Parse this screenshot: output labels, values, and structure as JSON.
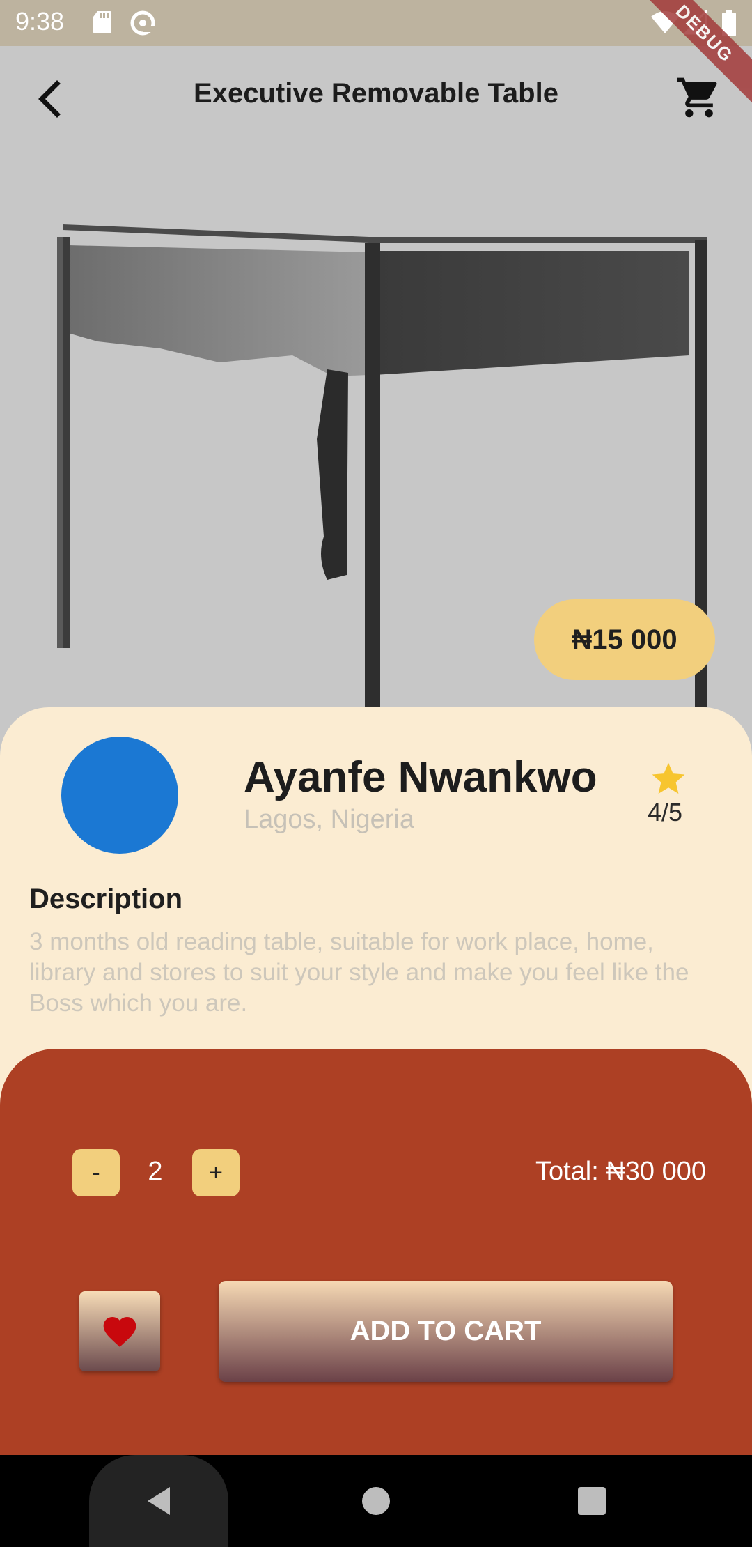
{
  "status_bar": {
    "time": "9:38",
    "icons": [
      "sd-card-icon",
      "data-saver-icon",
      "wifi-icon",
      "signal-icon",
      "battery-icon"
    ],
    "debug_banner": "DEBUG"
  },
  "header": {
    "title": "Executive Removable Table",
    "back_icon": "arrow-back-icon",
    "cart_icon": "cart-icon"
  },
  "product": {
    "price": "₦15 000"
  },
  "seller": {
    "name": "Ayanfe Nwankwo",
    "location": "Lagos, Nigeria",
    "rating": "4/5"
  },
  "description": {
    "heading": "Description",
    "text": "3 months old reading table, suitable for work place, home, library and stores to suit your style and make you feel like the Boss which you are."
  },
  "order": {
    "minus_label": "-",
    "quantity": "2",
    "plus_label": "+",
    "total": "Total: ₦30 000",
    "add_to_cart_label": "ADD TO CART"
  },
  "colors": {
    "price_pill": "#f2cf7d",
    "card_background": "#fbecd2",
    "order_panel": "#ad4024",
    "avatar": "#1b78d3",
    "star": "#f7c52f",
    "heart": "#c8080d"
  }
}
